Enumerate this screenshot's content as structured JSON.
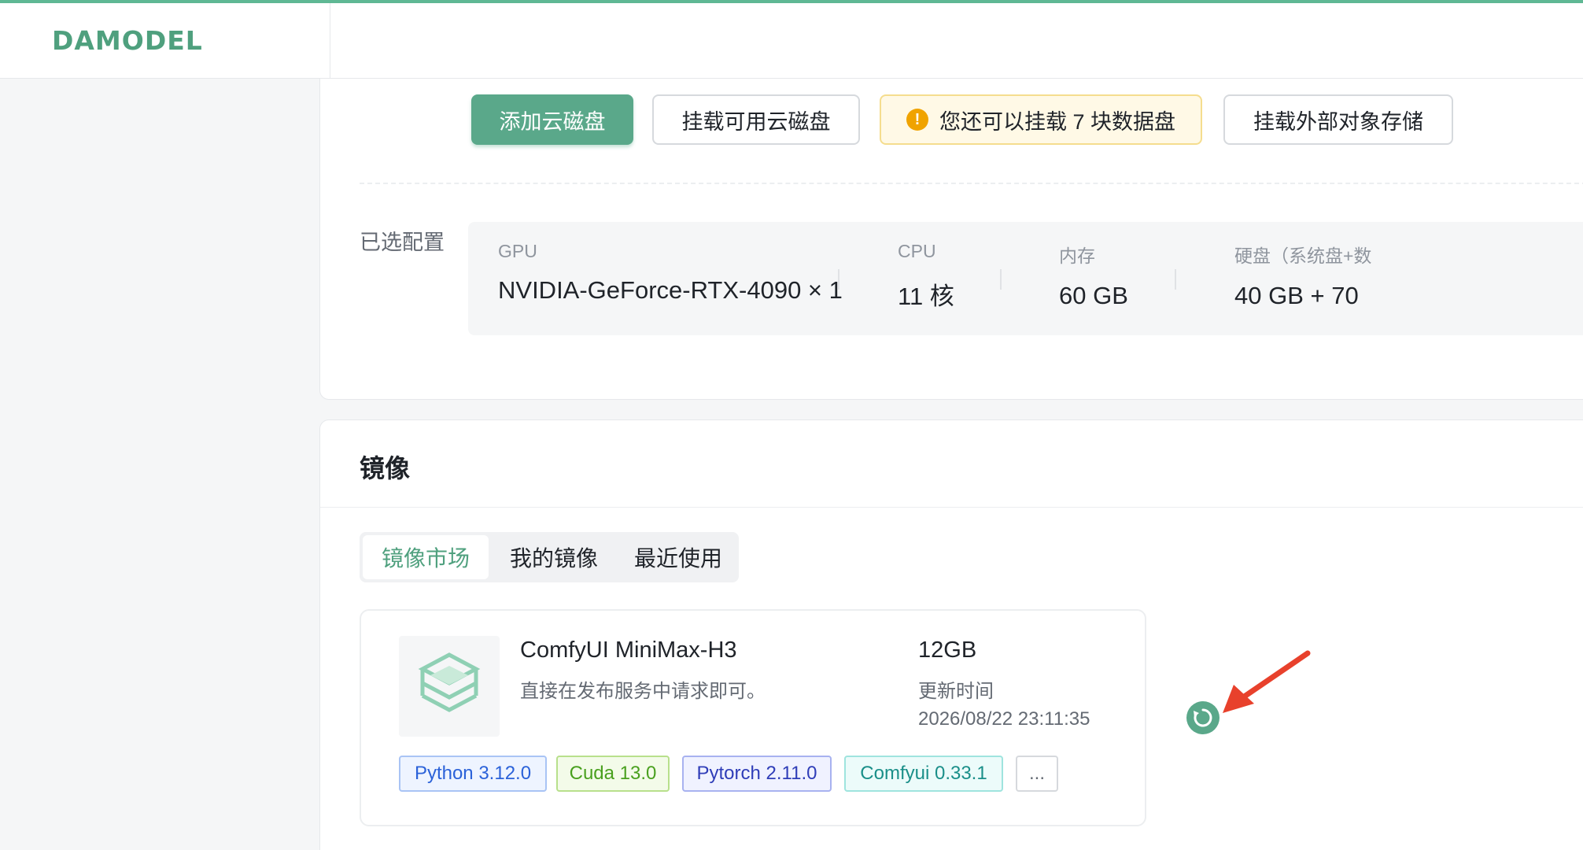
{
  "brand": {
    "logo": "DAMODEL",
    "accent": "#5aa88a"
  },
  "disk_actions": {
    "add_disk": "添加云磁盘",
    "mount_disk": "挂载可用云磁盘",
    "remaining_notice": "您还可以挂载 7 块数据盘",
    "mount_external": "挂载外部对象存储"
  },
  "config": {
    "label": "已选配置",
    "columns": [
      {
        "head": "GPU",
        "value": "NVIDIA-GeForce-RTX-4090 × 1"
      },
      {
        "head": "CPU",
        "value": "11 核"
      },
      {
        "head": "内存",
        "value": "60 GB"
      },
      {
        "head": "硬盘（系统盘+数",
        "value": "40 GB + 70"
      }
    ]
  },
  "image_section": {
    "title": "镜像",
    "tabs": [
      "镜像市场",
      "我的镜像",
      "最近使用"
    ],
    "active_tab": "镜像市场",
    "card": {
      "name": "ComfyUI MiniMax-H3",
      "description": "直接在发布服务中请求即可。",
      "size": "12GB",
      "updated_label": "更新时间",
      "updated_time": "2026/08/22 23:11:35",
      "tags": [
        "Python 3.12.0",
        "Cuda 13.0",
        "Pytorch 2.11.0",
        "Comfyui 0.33.1",
        "..."
      ]
    }
  },
  "icons": {
    "warning": "exclamation-circle-icon",
    "refresh": "refresh-icon",
    "thumbnail": "layers-icon",
    "annotation": "red-arrow"
  }
}
